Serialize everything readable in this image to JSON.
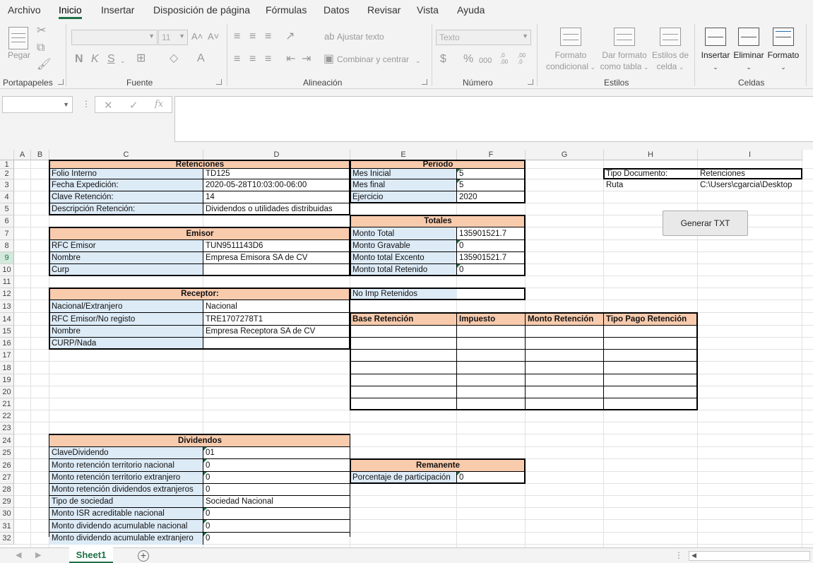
{
  "menu": [
    "Archivo",
    "Inicio",
    "Insertar",
    "Disposición de página",
    "Fórmulas",
    "Datos",
    "Revisar",
    "Vista",
    "Ayuda"
  ],
  "ribbon": {
    "clipboard": {
      "paste_label": "Pegar",
      "group_label": "Portapapeles"
    },
    "font": {
      "size": "11",
      "bold": "N",
      "italic": "K",
      "underline": "S",
      "grow": "A˄",
      "shrink": "A˅",
      "group_label": "Fuente"
    },
    "alignment": {
      "wrap_text": "Ajustar texto",
      "merge_center": "Combinar y centrar",
      "group_label": "Alineación"
    },
    "number": {
      "format": "Texto",
      "currency": "$",
      "percent": "%",
      "thousands": "000",
      "inc_decimal": ",0 ,00",
      "dec_decimal": ",00 ,0",
      "group_label": "Número"
    },
    "styles": {
      "conditional_1": "Formato",
      "conditional_2": "condicional",
      "table_1": "Dar formato",
      "table_2": "como tabla",
      "cell_1": "Estilos de",
      "cell_2": "celda",
      "group_label": "Estilos"
    },
    "cells": {
      "insert": "Insertar",
      "delete": "Eliminar",
      "format": "Formato",
      "group_label": "Celdas"
    }
  },
  "formula_bar": {
    "fx": "fx",
    "cancel": "✕",
    "enter": "✓",
    "dots": "⋮"
  },
  "columns": [
    "A",
    "B",
    "C",
    "D",
    "E",
    "F",
    "G",
    "H",
    "I"
  ],
  "rows": [
    "1",
    "2",
    "3",
    "4",
    "5",
    "6",
    "7",
    "8",
    "9",
    "10",
    "11",
    "12",
    "13",
    "14",
    "15",
    "16",
    "17",
    "18",
    "19",
    "20",
    "21",
    "22",
    "23",
    "24",
    "25",
    "26",
    "27",
    "28",
    "29",
    "30",
    "31",
    "32"
  ],
  "sheet": {
    "retenciones": {
      "header": "Retenciones",
      "rows": [
        [
          "Folio Interno",
          "TD125"
        ],
        [
          "Fecha Expedición:",
          "2020-05-28T10:03:00-06:00"
        ],
        [
          "Clave Retención:",
          "14"
        ],
        [
          "Descripción Retención:",
          "Dividendos o utilidades distribuidas"
        ]
      ]
    },
    "periodo": {
      "header": "Periodo",
      "rows": [
        [
          "Mes Inicial",
          "5"
        ],
        [
          "Mes final",
          "5"
        ],
        [
          "Ejercicio",
          "2020"
        ]
      ]
    },
    "tipo_documento": {
      "label": "Tipo Documento:",
      "value": "Retenciones"
    },
    "ruta": {
      "label": "Ruta",
      "value": "C:\\Users\\cgarcia\\Desktop"
    },
    "button": "Generar TXT",
    "emisor": {
      "header": "Emisor",
      "rows": [
        [
          "RFC Emisor",
          "TUN9511143D6"
        ],
        [
          "Nombre",
          "Empresa Emisora SA de CV"
        ],
        [
          "Curp",
          ""
        ]
      ]
    },
    "totales": {
      "header": "Totales",
      "rows": [
        [
          "Monto Total",
          "135901521.7"
        ],
        [
          "Monto Gravable",
          "0"
        ],
        [
          "Monto total Excento",
          "135901521.7"
        ],
        [
          "Monto total Retenido",
          "0"
        ]
      ]
    },
    "receptor": {
      "header": "Receptor:",
      "rows": [
        [
          "Nacional/Extranjero",
          "Nacional"
        ],
        [
          "RFC Emisor/No  registo",
          "TRE1707278T1"
        ],
        [
          "Nombre",
          "Empresa Receptora SA de CV"
        ],
        [
          "CURP/Nada",
          ""
        ]
      ]
    },
    "no_imp": "No Imp Retenidos",
    "impuestos_headers": [
      "Base Retención",
      "Impuesto",
      "Monto Retención",
      "Tipo Pago Retención"
    ],
    "dividendos": {
      "header": "Dividendos",
      "rows": [
        [
          "ClaveDividendo",
          "01"
        ],
        [
          "Monto retención territorio nacional",
          "0"
        ],
        [
          "Monto retención territorio extranjero",
          "0"
        ],
        [
          "Monto retención dividendos extranjeros",
          "0"
        ],
        [
          "Tipo de sociedad",
          "Sociedad Nacional"
        ],
        [
          "Monto ISR acreditable nacional",
          "0"
        ],
        [
          "Monto dividendo acumulable nacional",
          "0"
        ],
        [
          "Monto dividendo acumulable extranjero",
          "0"
        ]
      ]
    },
    "remanente": {
      "header": "Remanente",
      "label": "Porcentaje de participación",
      "value": "0"
    }
  },
  "tabs": {
    "sheet": "Sheet1",
    "add": "+"
  },
  "accent": "#1e7145",
  "label_fill": "#ddebf7",
  "header_fill": "#f8cbad"
}
